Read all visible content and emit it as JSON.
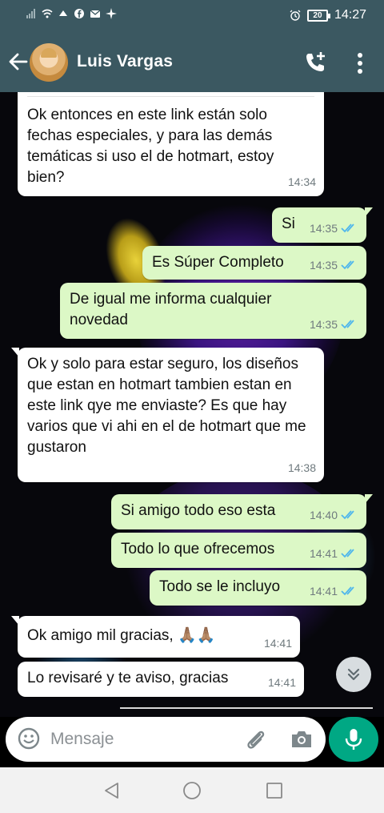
{
  "status_bar": {
    "time": "14:27",
    "battery": "20"
  },
  "header": {
    "contact_name": "Luis Vargas"
  },
  "messages": [
    {
      "dir": "in",
      "text": "Ok entonces en este link están solo fechas especiales, y para las demás temáticas si uso el de hotmart, estoy bien?",
      "time": "14:34"
    },
    {
      "dir": "out",
      "text": "Si",
      "time": "14:35",
      "status": "read"
    },
    {
      "dir": "out",
      "text": "Es Súper Completo",
      "time": "14:35",
      "status": "read"
    },
    {
      "dir": "out",
      "text": "De igual me informa cualquier novedad",
      "time": "14:35",
      "status": "read"
    },
    {
      "dir": "in",
      "text": "Ok y solo para estar seguro, los diseños que estan en hotmart tambien estan en este link qye me enviaste? Es que hay varios que vi ahi en el de hotmart que me gustaron",
      "time": "14:38"
    },
    {
      "dir": "out",
      "text": "Si amigo todo eso esta",
      "time": "14:40",
      "status": "read"
    },
    {
      "dir": "out",
      "text": "Todo lo que ofrecemos",
      "time": "14:41",
      "status": "read"
    },
    {
      "dir": "out",
      "text": "Todo se le incluyo",
      "time": "14:41",
      "status": "read"
    },
    {
      "dir": "in",
      "text": "Ok amigo mil gracias, 🙏🏽🙏🏽",
      "time": "14:41"
    },
    {
      "dir": "in",
      "text": "Lo revisaré y te aviso, gracias",
      "time": "14:41"
    }
  ],
  "composer": {
    "placeholder": "Mensaje"
  },
  "colors": {
    "header": "#3b5861",
    "incoming_bubble": "#ffffff",
    "outgoing_bubble": "#dcf8c6",
    "read_ticks": "#4fb6ec",
    "mic_button": "#00a884"
  },
  "icons": [
    "back-arrow-icon",
    "add-call-icon",
    "more-options-icon",
    "emoji-icon",
    "attach-icon",
    "camera-icon",
    "mic-icon",
    "scroll-down-icon",
    "nav-back-icon",
    "nav-home-icon",
    "nav-recent-icon"
  ]
}
